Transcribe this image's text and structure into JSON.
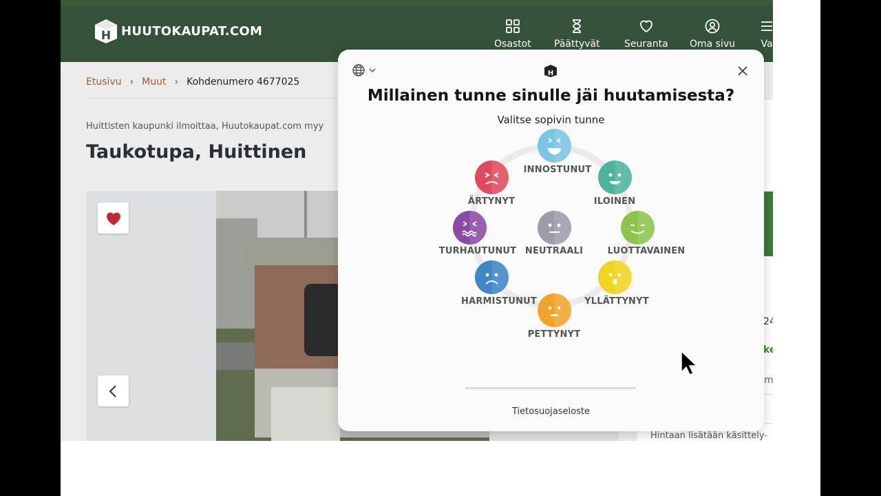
{
  "site": {
    "logo_text": "HUUTOKAUPAT.COM",
    "nav": [
      {
        "label": "Osastot",
        "icon": "grid-icon"
      },
      {
        "label": "Päättyvät",
        "icon": "hourglass-icon"
      },
      {
        "label": "Seuranta",
        "icon": "heart-icon"
      },
      {
        "label": "Oma sivu",
        "icon": "user-icon"
      },
      {
        "label": "Va",
        "icon": "menu-icon"
      }
    ],
    "breadcrumb": {
      "home": "Etusivu",
      "category": "Muut",
      "current": "Kohdenumero 4677025"
    },
    "seller_line": "Huittisten kaupunki ilmoittaa, Huutokaupat.com myy",
    "title": "Taukotupa, Huittinen",
    "side_fragments": {
      "number": "24",
      "green": "ke",
      "m": "m"
    },
    "price_note": "Hintaan lisätään käsittely-"
  },
  "modal": {
    "title": "Millainen tunne sinulle jäi huutamisesta?",
    "subtitle": "Valitse sopivin tunne",
    "emotions": [
      {
        "key": "innostunut",
        "label": "INNOSTUNUT",
        "color": "#7cc4e4"
      },
      {
        "key": "iloinen",
        "label": "ILOINEN",
        "color": "#4db39a"
      },
      {
        "key": "luottavainen",
        "label": "LUOTTAVAINEN",
        "color": "#8cc34a"
      },
      {
        "key": "yllattynyt",
        "label": "YLLÄTTYNYT",
        "color": "#f0d51f"
      },
      {
        "key": "pettynyt",
        "label": "PETTYNYT",
        "color": "#f2a42a"
      },
      {
        "key": "harmistunut",
        "label": "HARMISTUNUT",
        "color": "#3f86c5"
      },
      {
        "key": "turhautunut",
        "label": "TURHAUTUNUT",
        "color": "#8a4aa6"
      },
      {
        "key": "artynyt",
        "label": "ÄRTYNYT",
        "color": "#e04a5e"
      },
      {
        "key": "neutraali",
        "label": "NEUTRAALI",
        "color": "#9c9cab"
      }
    ],
    "privacy_link": "Tietosuojaseloste"
  }
}
